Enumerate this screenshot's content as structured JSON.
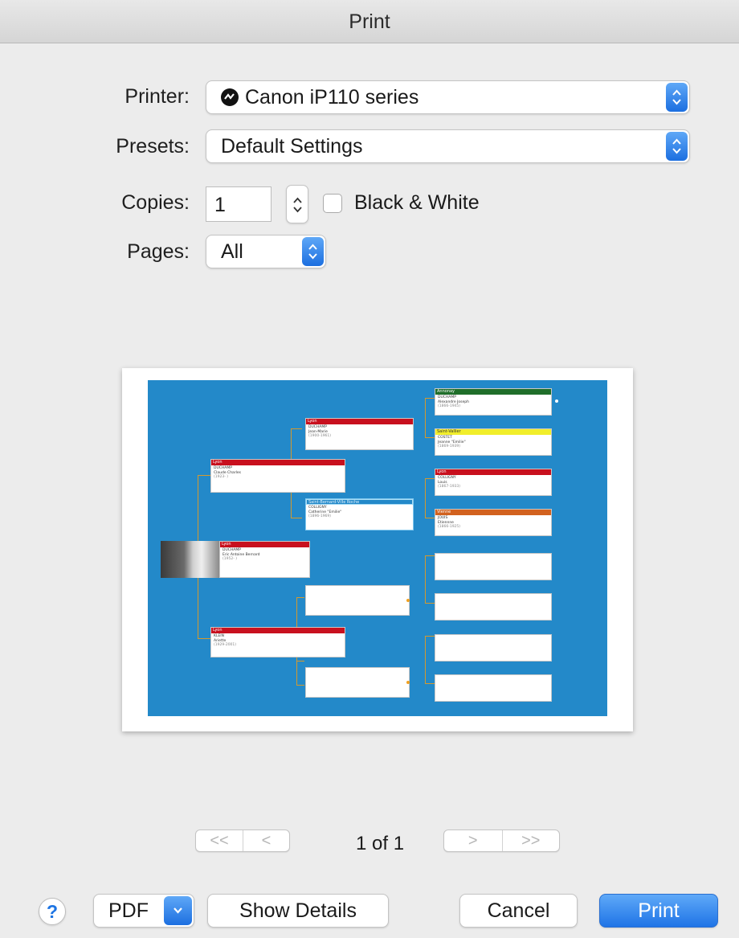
{
  "window": {
    "title": "Print"
  },
  "form": {
    "printer_label": "Printer:",
    "printer_value": "Canon iP110 series",
    "presets_label": "Presets:",
    "presets_value": "Default Settings",
    "copies_label": "Copies:",
    "copies_value": "1",
    "bw_label": "Black & White",
    "bw_checked": false,
    "pages_label": "Pages:",
    "pages_value": "All"
  },
  "preview": {
    "page_indicator": "1 of 1",
    "nav_first": "<<",
    "nav_prev": "<",
    "nav_next": ">",
    "nav_last": ">>",
    "tree": {
      "root": {
        "place": "Lyon",
        "surname": "DUCHAMP",
        "given": "Eric Antoine Bernard",
        "dates": "(1952- )"
      },
      "father": {
        "place": "Lyon",
        "surname": "DUCHAMP",
        "given": "Claude Charles",
        "dates": "(1923- )"
      },
      "mother": {
        "place": "Lyon",
        "surname": "KLEIN",
        "given": "Ariette",
        "dates": "(1929-2001)"
      },
      "pgf": {
        "place": "Lyon",
        "surname": "DUCHAMP",
        "given": "Jean-Marie",
        "dates": "(1900-1961)"
      },
      "pgm": {
        "place": "Saint-Bernard-Ville Roche",
        "surname": "COLLIGNY",
        "given": "Catherine \"Emilie\"",
        "dates": "(1896-1969)"
      },
      "ggf1": {
        "place": "Annonay",
        "surname": "DUCHAMP",
        "given": "Alexandre Joseph",
        "dates": "(1866-1945)"
      },
      "ggm1": {
        "place": "Saint-Vallier",
        "surname": "COSTET",
        "given": "Jeanne \"Emilie\"",
        "dates": "(1869-1939)"
      },
      "ggf2": {
        "place": "Lyon",
        "surname": "COLLIGNY",
        "given": "Louis",
        "dates": "(1867-1933)"
      },
      "ggm2": {
        "place": "Vienne",
        "surname": "JOUIS",
        "given": "Etiennne",
        "dates": "(1866-1925)"
      }
    },
    "colors": {
      "background": "#2389c9",
      "connector": "#d4992e",
      "header_red": "#c8101e",
      "header_green": "#1f6e2a",
      "header_yellow": "#f1ee2b",
      "header_orange": "#d2621f",
      "header_outline": "#2389c9"
    }
  },
  "buttons": {
    "help": "?",
    "pdf": "PDF",
    "show_details": "Show Details",
    "cancel": "Cancel",
    "print": "Print"
  }
}
